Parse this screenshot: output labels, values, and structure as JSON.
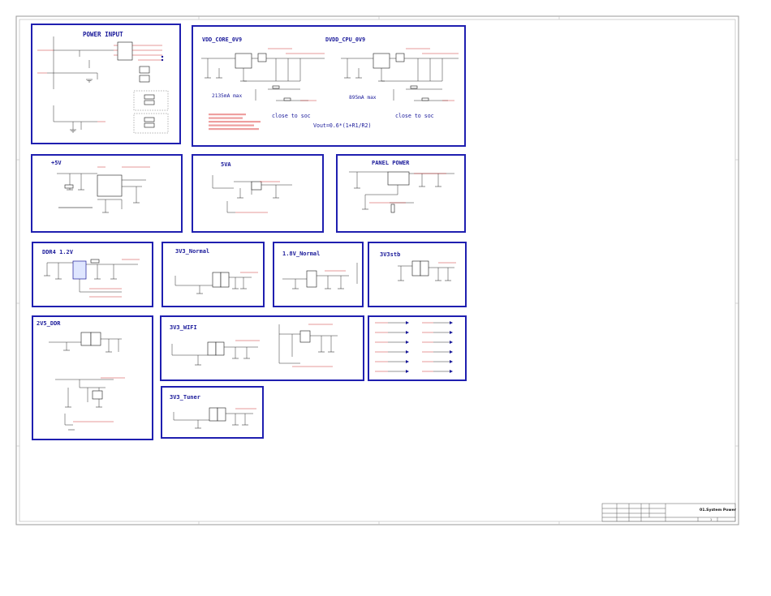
{
  "blocks": {
    "power_input": {
      "title": "POWER INPUT"
    },
    "vdd_core": {
      "title": "VDD_CORE_0V9",
      "current": "2135mA max",
      "note": "close to soc"
    },
    "dvdd_cpu": {
      "title": "DVDD_CPU_0V9",
      "current": "895mA max",
      "note": "close to soc"
    },
    "vout_formula": "Vout=0.6*(1+R1/R2)",
    "plus5v": {
      "title": "+5V"
    },
    "v5a": {
      "title": "5VA"
    },
    "panel_power": {
      "title": "PANEL POWER"
    },
    "ddr4": {
      "title": "DDR4 1.2V"
    },
    "v3v3_normal": {
      "title": "3V3_Normal"
    },
    "v1v8_normal": {
      "title": "1.8V_Normal"
    },
    "v3v3stb": {
      "title": "3V3stb"
    },
    "v2v5_ddr": {
      "title": "2V5_DDR"
    },
    "v3v3_wifi": {
      "title": "3V3_WIFI"
    },
    "v3v3_tuner": {
      "title": "3V3_Tuner"
    }
  },
  "title_block": {
    "sheet_title": "01.System Power",
    "page": "1"
  }
}
